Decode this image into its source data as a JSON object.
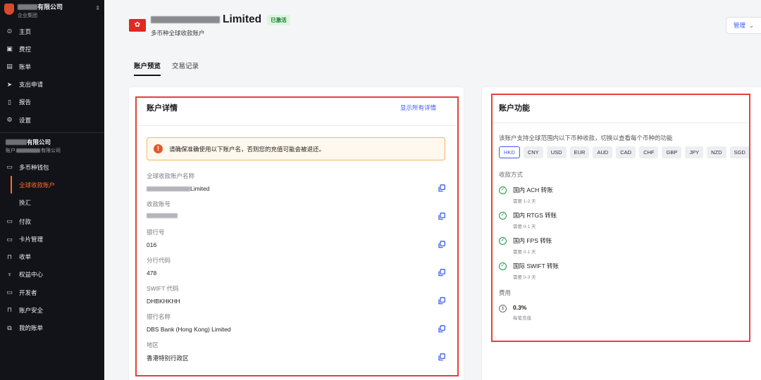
{
  "org": {
    "name_suffix": "有限公司",
    "group": "企业集团"
  },
  "nav": [
    {
      "icon": "⊙",
      "label": "主页",
      "name": "home"
    },
    {
      "icon": "▣",
      "label": "费控",
      "name": "expense"
    },
    {
      "icon": "▤",
      "label": "账单",
      "name": "bills"
    },
    {
      "icon": "➤",
      "label": "支出申请",
      "name": "spend-request"
    },
    {
      "icon": "▯",
      "label": "报告",
      "name": "reports"
    },
    {
      "icon": "⚙",
      "label": "设置",
      "name": "settings"
    }
  ],
  "account": {
    "name_suffix": "有限公司",
    "sub_prefix": "账户",
    "sub_suffix": "有限公司"
  },
  "nav2": {
    "wallet": "多币种钱包",
    "sub": [
      "全球收款账户",
      "换汇"
    ],
    "items": [
      {
        "icon": "▭",
        "label": "付款",
        "name": "payments"
      },
      {
        "icon": "▭",
        "label": "卡片管理",
        "name": "cards"
      },
      {
        "icon": "⊓",
        "label": "收单",
        "name": "acquiring"
      },
      {
        "icon": "♆",
        "label": "权益中心",
        "name": "benefits"
      },
      {
        "icon": "▭",
        "label": "开发者",
        "name": "developer"
      },
      {
        "icon": "⊓",
        "label": "账户安全",
        "name": "security"
      },
      {
        "icon": "⧉",
        "label": "我的账单",
        "name": "my-bills"
      }
    ]
  },
  "header": {
    "flag": "✿",
    "title_suffix": "Limited",
    "badge": "已激活",
    "subtitle": "多币种全球收款账户",
    "manage": "管理",
    "tabs": [
      "账户预览",
      "交易记录"
    ]
  },
  "details": {
    "title": "账户详情",
    "show_all": "显示所有详情",
    "warning": "请确保准确使用以下账户名，否则您的充值可能会被退还。",
    "fields": [
      {
        "label": "全球收款账户名称",
        "value": "Limited",
        "masked": true
      },
      {
        "label": "收款账号",
        "value": "",
        "masked": true
      },
      {
        "label": "银行号",
        "value": "016"
      },
      {
        "label": "分行代码",
        "value": "478"
      },
      {
        "label": "SWIFT 代码",
        "value": "DHBKHKHH"
      },
      {
        "label": "银行名称",
        "value": "DBS Bank (Hong Kong) Limited"
      },
      {
        "label": "地区",
        "value": "香港特别行政区"
      }
    ]
  },
  "features": {
    "title": "账户功能",
    "intro": "该账户支持全球范围内以下币种收款，切换以查看每个币种的功能",
    "currencies": [
      "HKD",
      "CNY",
      "USD",
      "EUR",
      "AUD",
      "CAD",
      "CHF",
      "GBP",
      "JPY",
      "NZD",
      "SGD"
    ],
    "selected_currency": "HKD",
    "methods_label": "收款方式",
    "methods": [
      {
        "name": "国内 ACH 转账",
        "time": "需要 1-2 天"
      },
      {
        "name": "国内 RTGS 转账",
        "time": "需要 0-1 天"
      },
      {
        "name": "国内 FPS 转账",
        "time": "需要 0-1 天"
      },
      {
        "name": "国际 SWIFT 转账",
        "time": "需要 0-3 天"
      }
    ],
    "fee_label": "费用",
    "fee": {
      "value": "0.3%",
      "note": "每笔充值"
    }
  },
  "colors": {
    "accent": "#3d5af1",
    "brand_orange": "#ff6a2c",
    "highlight_red": "#e6403b",
    "success": "#1b9a45"
  }
}
